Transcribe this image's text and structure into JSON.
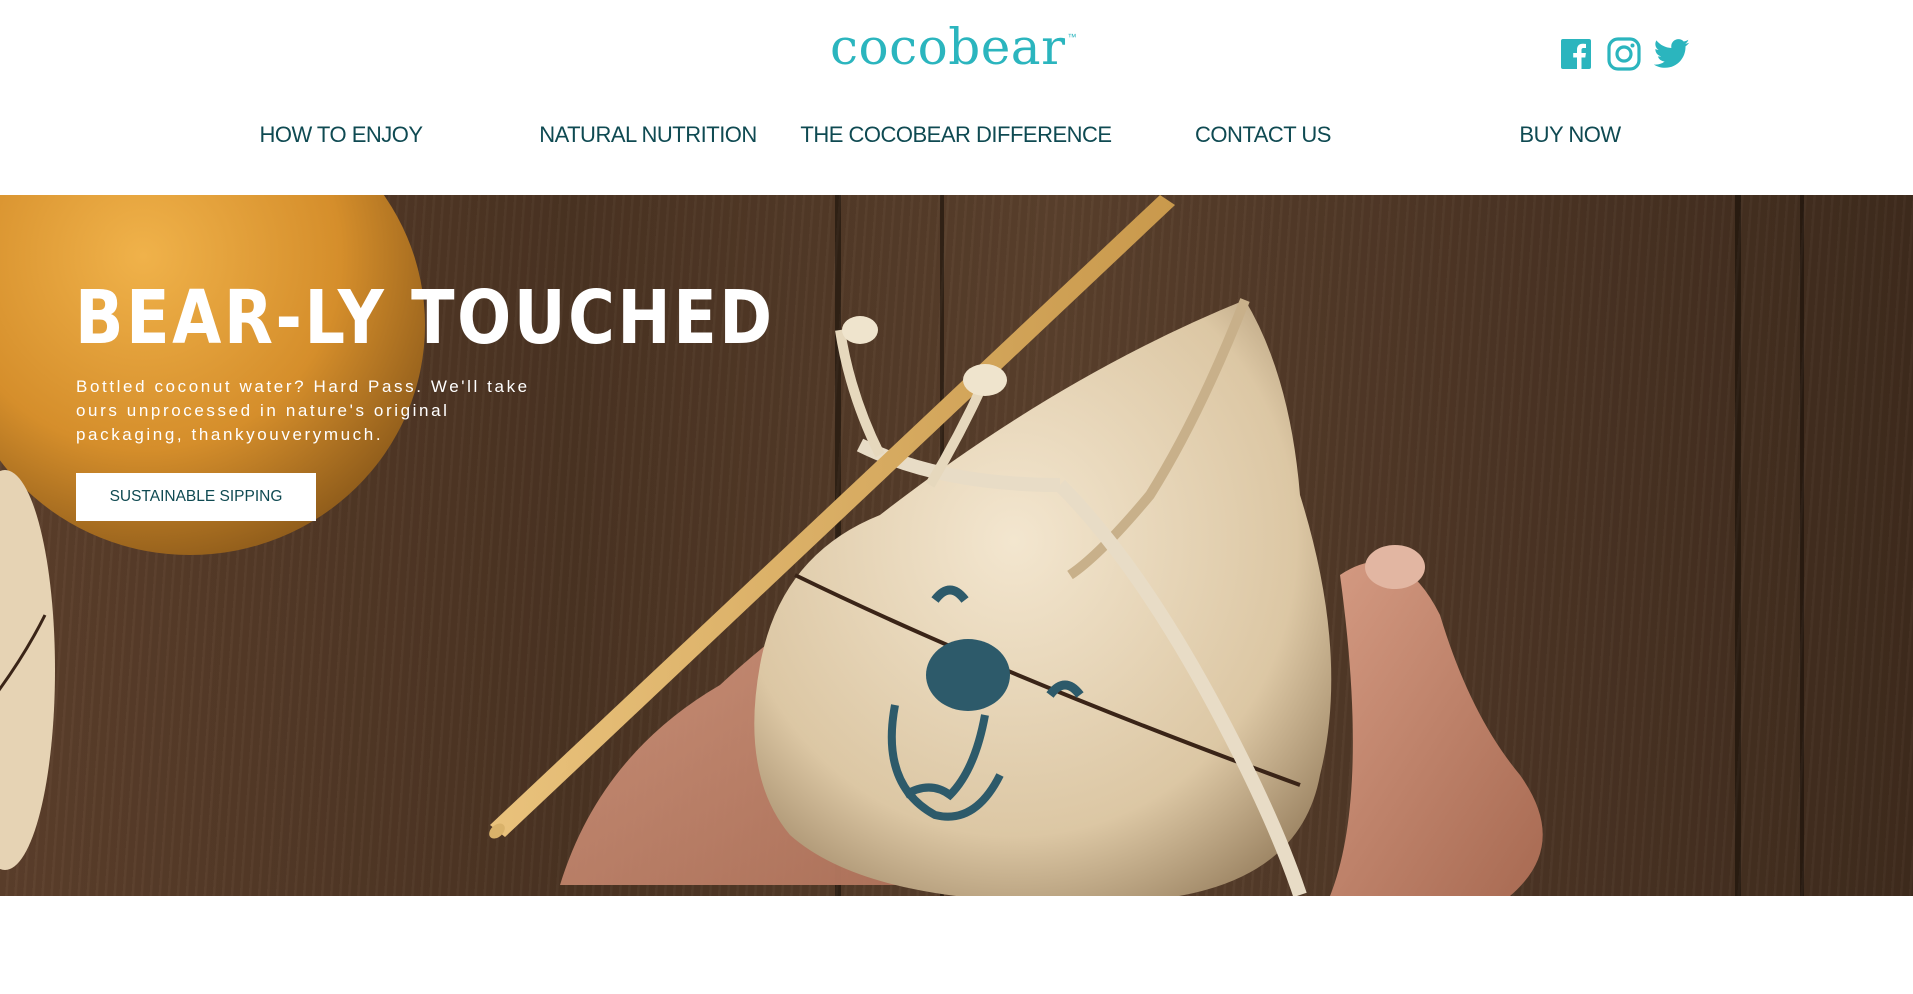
{
  "brand": {
    "name": "cocobear",
    "trademark": "™",
    "color": "#2bb5be"
  },
  "social": [
    {
      "name": "facebook-icon"
    },
    {
      "name": "instagram-icon"
    },
    {
      "name": "twitter-icon"
    }
  ],
  "nav": {
    "items": [
      {
        "label": "HOW TO ENJOY"
      },
      {
        "label": "NATURAL NUTRITION"
      },
      {
        "label": "THE COCOBEAR DIFFERENCE"
      },
      {
        "label": "CONTACT US"
      },
      {
        "label": "BUY NOW"
      }
    ],
    "color": "#0f4a52"
  },
  "hero": {
    "headline": "BEAR-LY TOUCHED",
    "subtext": "Bottled coconut water? Hard Pass. We'll take ours unprocessed in nature's original packaging, thankyouverymuch.",
    "cta_label": "SUSTAINABLE SIPPING"
  }
}
